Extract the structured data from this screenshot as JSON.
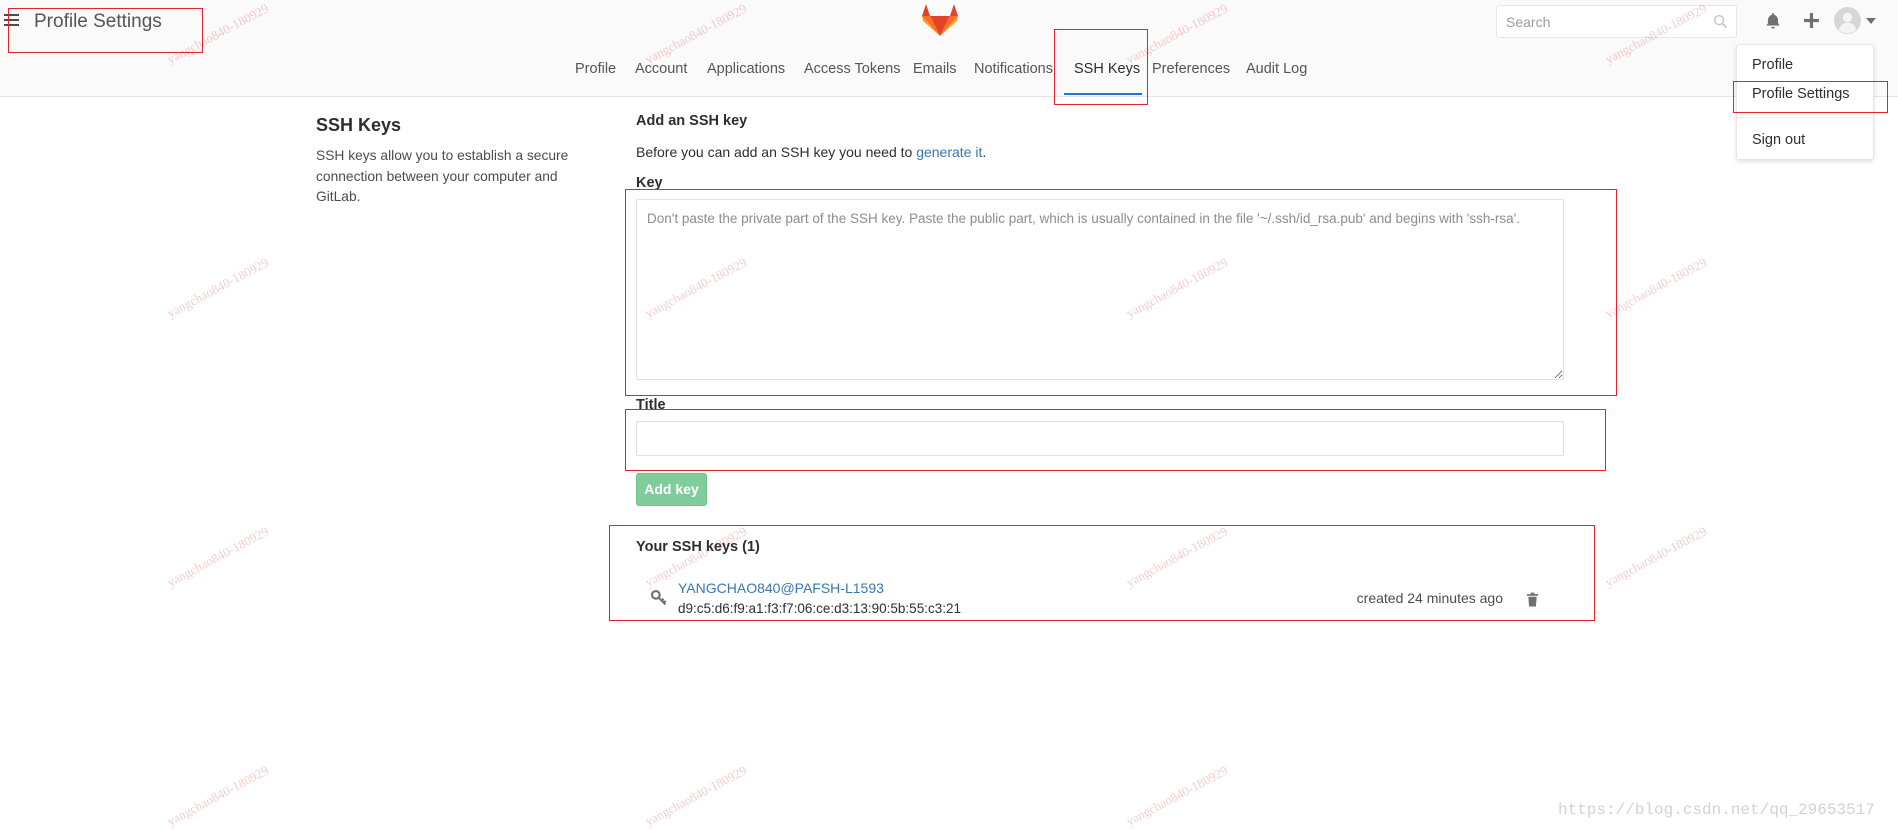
{
  "header": {
    "title": "Profile Settings",
    "search_placeholder": "Search"
  },
  "nav": {
    "tabs": [
      {
        "label": "Profile"
      },
      {
        "label": "Account"
      },
      {
        "label": "Applications"
      },
      {
        "label": "Access Tokens"
      },
      {
        "label": "Emails"
      },
      {
        "label": "Notifications"
      },
      {
        "label": "SSH Keys"
      },
      {
        "label": "Preferences"
      },
      {
        "label": "Audit Log"
      }
    ],
    "active_index": 6
  },
  "user_menu": {
    "items": [
      {
        "label": "Profile"
      },
      {
        "label": "Profile Settings"
      },
      {
        "label": "Sign out"
      }
    ]
  },
  "sidebar": {
    "heading": "SSH Keys",
    "description_lines": [
      "SSH keys allow you to establish a secure",
      "connection between your computer and",
      "GitLab."
    ]
  },
  "form": {
    "heading": "Add an SSH key",
    "intro_prefix": "Before you can add an SSH key you need to ",
    "intro_link": "generate it",
    "intro_suffix": ".",
    "key_label": "Key",
    "key_placeholder": "Don't paste the private part of the SSH key. Paste the public part, which is usually contained in the file '~/.ssh/id_rsa.pub' and begins with 'ssh-rsa'.",
    "title_label": "Title",
    "submit_label": "Add key"
  },
  "keys": {
    "heading": "Your SSH keys (1)",
    "items": [
      {
        "title": "YANGCHAO840@PAFSH-L1593",
        "fingerprint": "d9:c5:d6:f9:a1:f3:f7:06:ce:d3:13:90:5b:55:c3:21",
        "created": "created 24 minutes ago"
      }
    ]
  },
  "watermark": "yangchao840-180929",
  "footer_url": "https://blog.csdn.net/qq_29653517",
  "icons": {
    "menu": "hamburger-icon",
    "logo": "gitlab-logo-icon",
    "search": "search-icon",
    "notifications": "bell-icon",
    "new": "plus-icon",
    "avatar": "avatar-icon",
    "dropdown": "caret-down-icon",
    "key": "key-icon",
    "delete": "trash-icon"
  },
  "colors": {
    "link": "#3777b0",
    "active_tab_underline": "#1f78d1",
    "success_button": "#80cd9b",
    "annotation_red": "#e3242b",
    "brand_red": "#e24329",
    "brand_orange": "#fc6d26",
    "brand_yellow": "#fca326"
  }
}
